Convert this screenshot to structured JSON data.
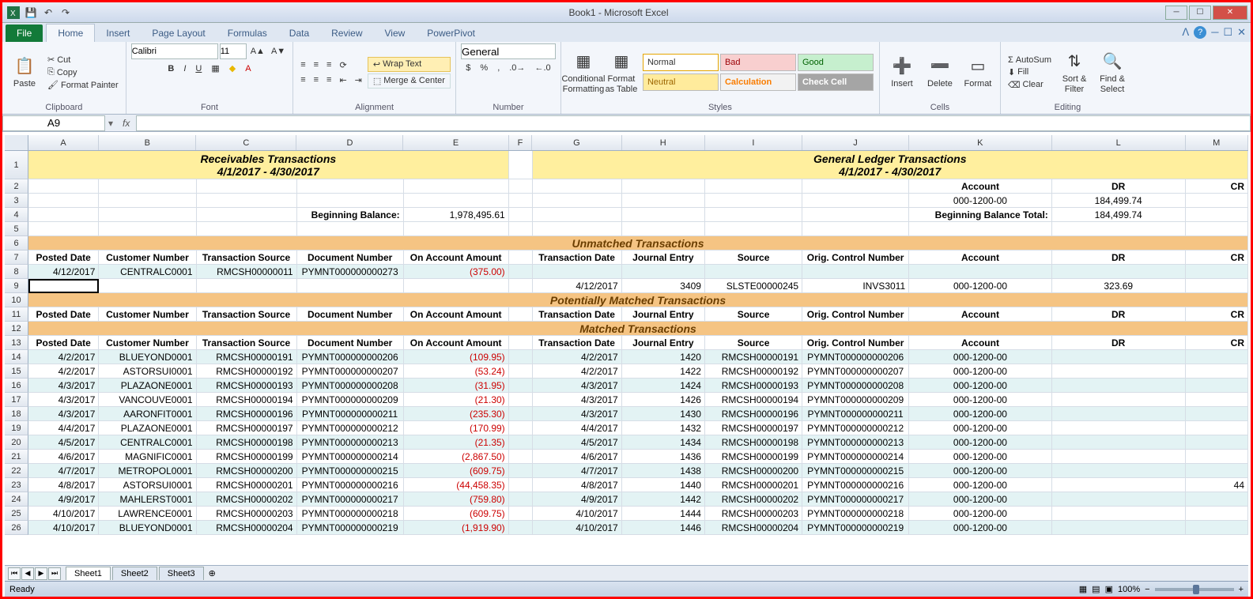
{
  "window": {
    "title": "Book1 - Microsoft Excel"
  },
  "ribbon": {
    "file": "File",
    "tabs": [
      "Home",
      "Insert",
      "Page Layout",
      "Formulas",
      "Data",
      "Review",
      "View",
      "PowerPivot"
    ],
    "activeTab": "Home",
    "clipboard": {
      "paste": "Paste",
      "cut": "Cut",
      "copy": "Copy",
      "formatPainter": "Format Painter",
      "label": "Clipboard"
    },
    "font": {
      "name": "Calibri",
      "size": "11",
      "label": "Font"
    },
    "alignment": {
      "wrap": "Wrap Text",
      "merge": "Merge & Center",
      "label": "Alignment"
    },
    "number": {
      "format": "General",
      "label": "Number"
    },
    "styles": {
      "cond": "Conditional Formatting",
      "table": "Format as Table",
      "label": "Styles",
      "cells": [
        [
          "Normal",
          "Bad",
          "Good"
        ],
        [
          "Neutral",
          "Calculation",
          "Check Cell"
        ]
      ]
    },
    "cells": {
      "insert": "Insert",
      "delete": "Delete",
      "format": "Format",
      "label": "Cells"
    },
    "editing": {
      "autosum": "AutoSum",
      "fill": "Fill",
      "clear": "Clear",
      "sort": "Sort & Filter",
      "find": "Find & Select",
      "label": "Editing"
    }
  },
  "namebox": "A9",
  "columns": [
    "A",
    "B",
    "C",
    "D",
    "E",
    "F",
    "G",
    "H",
    "I",
    "J",
    "K",
    "L",
    "M"
  ],
  "leftTitle": "Receivables Transactions",
  "rightTitle": "General Ledger Transactions",
  "dateRange": "4/1/2017 - 4/30/2017",
  "acct": {
    "label": "Account",
    "dr": "DR",
    "cr": "CR",
    "num": "000-1200-00",
    "drval": "184,499.74",
    "begbal": "Beginning Balance Total:",
    "begval": "184,499.74"
  },
  "begBalL": {
    "label": "Beginning Balance:",
    "val": "1,978,495.61"
  },
  "sections": {
    "unmatched": "Unmatched Transactions",
    "potential": "Potentially Matched Transactions",
    "matched": "Matched Transactions"
  },
  "headL": [
    "Posted Date",
    "Customer Number",
    "Transaction Source",
    "Document Number",
    "On Account Amount"
  ],
  "headR": [
    "Transaction Date",
    "Journal Entry",
    "Source",
    "Orig. Control Number",
    "Account",
    "DR",
    "CR"
  ],
  "unmatchedL": {
    "date": "4/12/2017",
    "cust": "CENTRALC0001",
    "src": "RMCSH00000011",
    "doc": "PYMNT000000000273",
    "amt": "(375.00)"
  },
  "unmatchedR": {
    "date": "4/12/2017",
    "je": "3409",
    "src": "SLSTE00000245",
    "ctl": "INVS3011",
    "acct": "000-1200-00",
    "dr": "323.69"
  },
  "matched": [
    {
      "d": "4/2/2017",
      "c": "BLUEYOND0001",
      "s": "RMCSH00000191",
      "doc": "PYMNT000000000206",
      "a": "(109.95)",
      "td": "4/2/2017",
      "je": "1420",
      "gs": "RMCSH00000191",
      "ctl": "PYMNT000000000206",
      "ac": "000-1200-00"
    },
    {
      "d": "4/2/2017",
      "c": "ASTORSUI0001",
      "s": "RMCSH00000192",
      "doc": "PYMNT000000000207",
      "a": "(53.24)",
      "td": "4/2/2017",
      "je": "1422",
      "gs": "RMCSH00000192",
      "ctl": "PYMNT000000000207",
      "ac": "000-1200-00"
    },
    {
      "d": "4/3/2017",
      "c": "PLAZAONE0001",
      "s": "RMCSH00000193",
      "doc": "PYMNT000000000208",
      "a": "(31.95)",
      "td": "4/3/2017",
      "je": "1424",
      "gs": "RMCSH00000193",
      "ctl": "PYMNT000000000208",
      "ac": "000-1200-00"
    },
    {
      "d": "4/3/2017",
      "c": "VANCOUVE0001",
      "s": "RMCSH00000194",
      "doc": "PYMNT000000000209",
      "a": "(21.30)",
      "td": "4/3/2017",
      "je": "1426",
      "gs": "RMCSH00000194",
      "ctl": "PYMNT000000000209",
      "ac": "000-1200-00"
    },
    {
      "d": "4/3/2017",
      "c": "AARONFIT0001",
      "s": "RMCSH00000196",
      "doc": "PYMNT000000000211",
      "a": "(235.30)",
      "td": "4/3/2017",
      "je": "1430",
      "gs": "RMCSH00000196",
      "ctl": "PYMNT000000000211",
      "ac": "000-1200-00"
    },
    {
      "d": "4/4/2017",
      "c": "PLAZAONE0001",
      "s": "RMCSH00000197",
      "doc": "PYMNT000000000212",
      "a": "(170.99)",
      "td": "4/4/2017",
      "je": "1432",
      "gs": "RMCSH00000197",
      "ctl": "PYMNT000000000212",
      "ac": "000-1200-00"
    },
    {
      "d": "4/5/2017",
      "c": "CENTRALC0001",
      "s": "RMCSH00000198",
      "doc": "PYMNT000000000213",
      "a": "(21.35)",
      "td": "4/5/2017",
      "je": "1434",
      "gs": "RMCSH00000198",
      "ctl": "PYMNT000000000213",
      "ac": "000-1200-00"
    },
    {
      "d": "4/6/2017",
      "c": "MAGNIFIC0001",
      "s": "RMCSH00000199",
      "doc": "PYMNT000000000214",
      "a": "(2,867.50)",
      "td": "4/6/2017",
      "je": "1436",
      "gs": "RMCSH00000199",
      "ctl": "PYMNT000000000214",
      "ac": "000-1200-00"
    },
    {
      "d": "4/7/2017",
      "c": "METROPOL0001",
      "s": "RMCSH00000200",
      "doc": "PYMNT000000000215",
      "a": "(609.75)",
      "td": "4/7/2017",
      "je": "1438",
      "gs": "RMCSH00000200",
      "ctl": "PYMNT000000000215",
      "ac": "000-1200-00"
    },
    {
      "d": "4/8/2017",
      "c": "ASTORSUI0001",
      "s": "RMCSH00000201",
      "doc": "PYMNT000000000216",
      "a": "(44,458.35)",
      "td": "4/8/2017",
      "je": "1440",
      "gs": "RMCSH00000201",
      "ctl": "PYMNT000000000216",
      "ac": "000-1200-00",
      "cr": "44"
    },
    {
      "d": "4/9/2017",
      "c": "MAHLERST0001",
      "s": "RMCSH00000202",
      "doc": "PYMNT000000000217",
      "a": "(759.80)",
      "td": "4/9/2017",
      "je": "1442",
      "gs": "RMCSH00000202",
      "ctl": "PYMNT000000000217",
      "ac": "000-1200-00"
    },
    {
      "d": "4/10/2017",
      "c": "LAWRENCE0001",
      "s": "RMCSH00000203",
      "doc": "PYMNT000000000218",
      "a": "(609.75)",
      "td": "4/10/2017",
      "je": "1444",
      "gs": "RMCSH00000203",
      "ctl": "PYMNT000000000218",
      "ac": "000-1200-00"
    },
    {
      "d": "4/10/2017",
      "c": "BLUEYOND0001",
      "s": "RMCSH00000204",
      "doc": "PYMNT000000000219",
      "a": "(1,919.90)",
      "td": "4/10/2017",
      "je": "1446",
      "gs": "RMCSH00000204",
      "ctl": "PYMNT000000000219",
      "ac": "000-1200-00"
    }
  ],
  "sheets": [
    "Sheet1",
    "Sheet2",
    "Sheet3"
  ],
  "status": {
    "ready": "Ready",
    "zoom": "100%"
  }
}
